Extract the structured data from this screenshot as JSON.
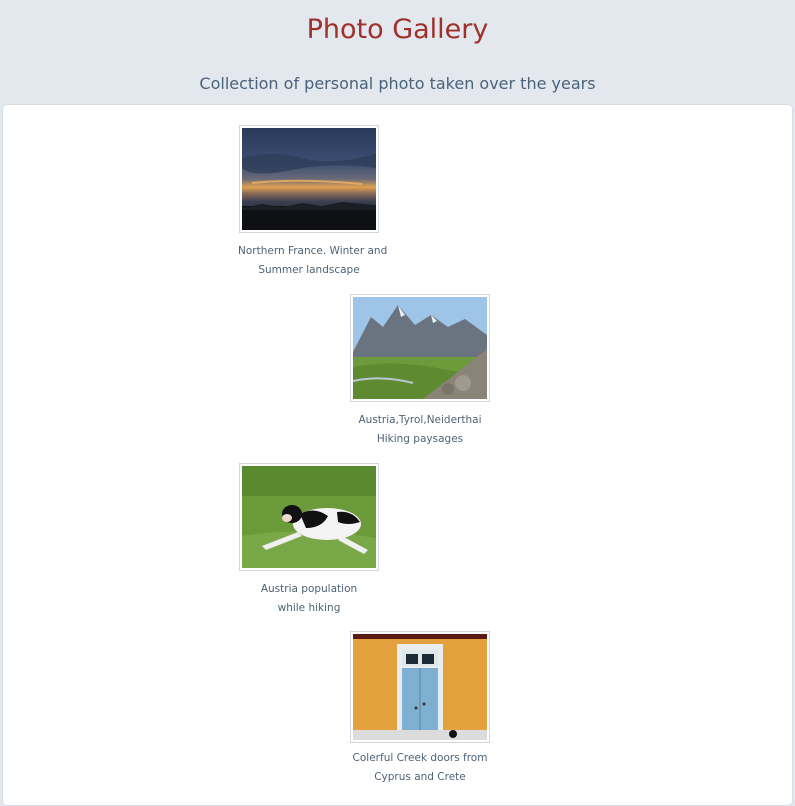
{
  "page": {
    "title": "Photo Gallery",
    "subtitle": "Collection of personal photo taken over the years"
  },
  "gallery": {
    "items": [
      {
        "caption_line1": "Northern France. Winter and",
        "caption_line2": "Summer landscape",
        "image": "sunset-landscape"
      },
      {
        "caption_line1": "Austria,Tyrol,Neiderthai",
        "caption_line2": "Hiking paysages",
        "image": "mountain-valley"
      },
      {
        "caption_line1": "Austria population",
        "caption_line2": "while hiking",
        "image": "cow-on-grass"
      },
      {
        "caption_line1": "Colerful Creek doors from",
        "caption_line2": "Cyprus and Crete",
        "image": "blue-door-yellow-wall"
      }
    ]
  },
  "colors": {
    "background": "#e2e8ee",
    "title": "#a0302a",
    "subtitle": "#4a627a",
    "caption": "#4e6275"
  }
}
